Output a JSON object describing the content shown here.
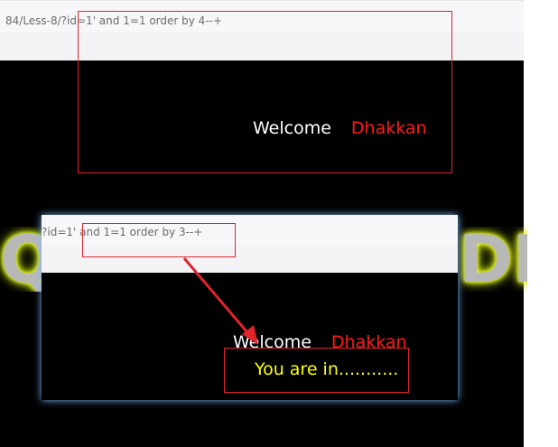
{
  "top_screenshot": {
    "url_text": "84/Less-8/?id=1' and 1=1 order by 4--+",
    "welcome_text": "Welcome",
    "user_name": "Dhakkan"
  },
  "banner": {
    "left_text": "QL",
    "right_text": "DEI"
  },
  "inset_screenshot": {
    "url_text": "?id=1' and 1=1 order by 3--+",
    "welcome_text": "Welcome",
    "user_name": "Dhakkan",
    "status_text": "You are in..........."
  },
  "colors": {
    "page_background": "#000000",
    "name_color": "#ff1a1a",
    "status_color": "#ffff00",
    "annotation_color": "#e0242b"
  }
}
